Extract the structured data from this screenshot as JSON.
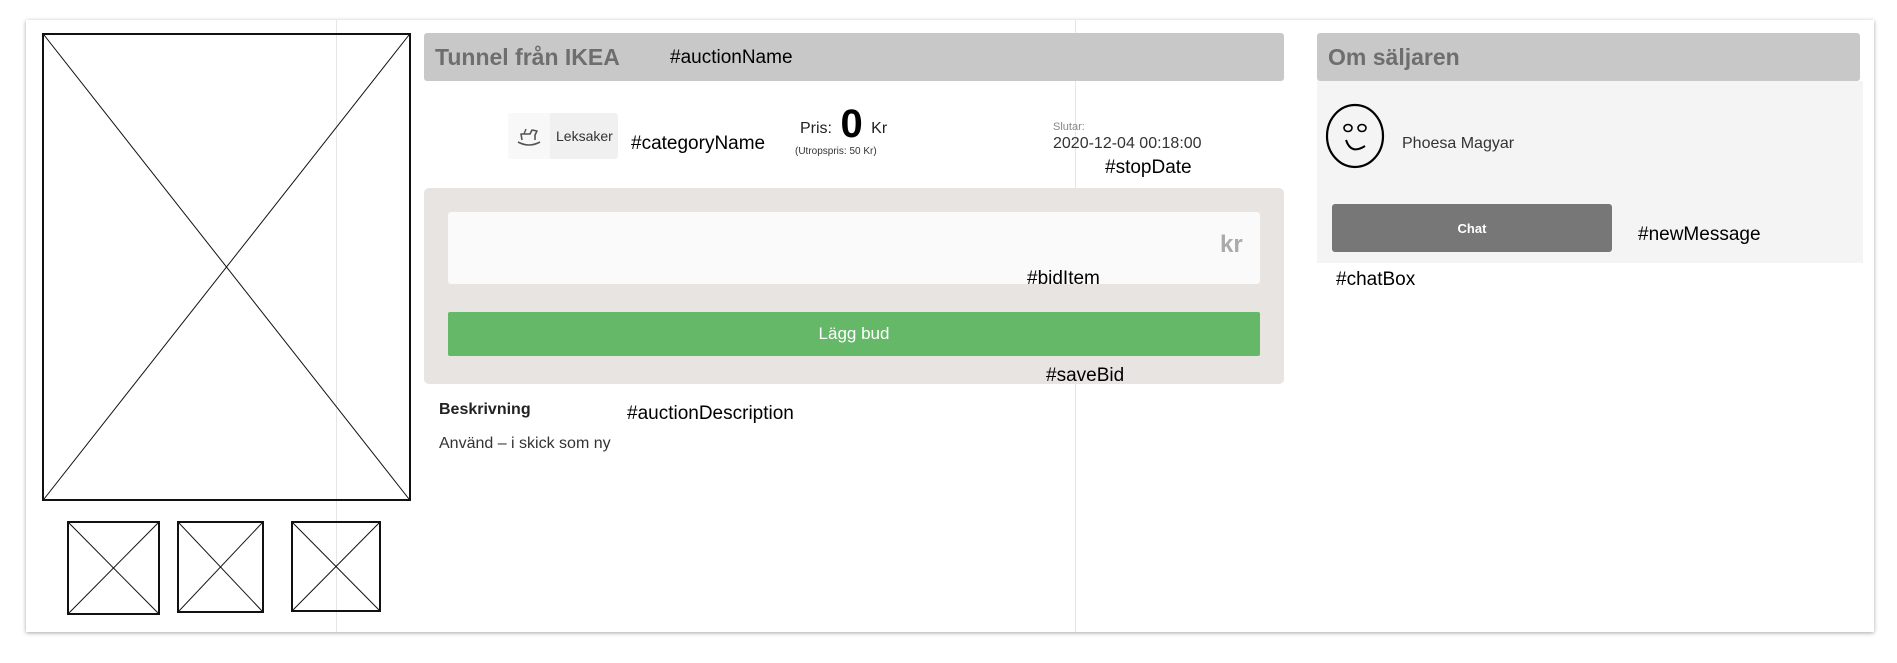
{
  "auction": {
    "title": "Tunnel från IKEA",
    "category_label": "Leksaker",
    "category_icon": "rocking-horse-icon",
    "price_label": "Pris:",
    "price_value": "0",
    "price_currency": "Kr",
    "start_price_note": "(Utropspris: 50 Kr)",
    "ends_label": "Slutar:",
    "ends_value": "2020-12-04 00:18:00",
    "bid_suffix": "kr",
    "bid_value": "",
    "bid_button_label": "Lägg bud",
    "description_title": "Beskrivning",
    "description_text": "Använd – i skick som ny"
  },
  "seller": {
    "title": "Om säljaren",
    "name": "Phoesa Magyar",
    "avatar_icon": "smiley-face-icon",
    "chat_button_label": "Chat"
  },
  "annotations": {
    "auction_name": "#auctionName",
    "category_name": "#categoryName",
    "stop_date": "#stopDate",
    "bid_item": "#bidItem",
    "save_bid": "#saveBid",
    "auction_description": "#auctionDescription",
    "new_message": "#newMessage",
    "chat_box": "#chatBox"
  },
  "colors": {
    "header_bar": "#c8c8c8",
    "header_text": "#6e6e6e",
    "bid_panel": "#e8e4e2",
    "bid_button": "#64b868",
    "chat_button": "#777777",
    "seller_panel": "#f4f4f4"
  }
}
